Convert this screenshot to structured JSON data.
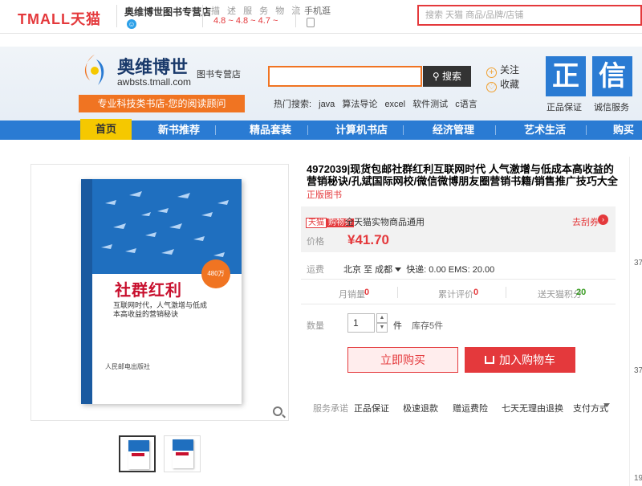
{
  "topbar": {
    "logo_text": "TMALL",
    "logo_cn": "天猫",
    "store_name": "奥维博世图书专营店",
    "ratings_label": "描 述 服 务 物 流",
    "ratings_values": "4.8 ~ 4.8 ~ 4.7 ~",
    "mobile_label": "手机逛",
    "search_placeholder": "搜索 天猫 商品/品牌/店铺"
  },
  "header": {
    "brand_title": "奥维博世",
    "brand_sub": "图书专营店",
    "brand_url": "awbsts.tmall.com",
    "slogan": "专业科技类书店-您的阅读顾问",
    "search_button": "搜索",
    "hot_search_label": "热门搜索:",
    "hot_search_items": [
      "java",
      "算法导论",
      "excel",
      "软件测试",
      "c语言"
    ],
    "follow": "关注",
    "collect": "收藏",
    "badge1_char": "正",
    "badge1_label": "正品保证",
    "badge2_char": "信",
    "badge2_label": "诚信服务"
  },
  "nav": {
    "items": [
      "首页",
      "新书推荐",
      "精品套装",
      "计算机书店",
      "经济管理",
      "艺术生活",
      "购买须知"
    ]
  },
  "cover": {
    "title": "社群红利",
    "subtitle": "互联网时代，人气激增与低成本高收益的营销秘诀",
    "circle": "480万",
    "bottom_text": "人民邮电出版社"
  },
  "product": {
    "title": "4972039|现货包邮社群红利互联网时代 人气激增与低成本高收益的营销秘诀/孔斌国际网校/微信微博朋友圈营销书籍/销售推广技巧大全",
    "tag": "正版图书",
    "tm_badge_a": "天猫",
    "tm_badge_b": "购物券",
    "promo_text": "全天猫实物商品通用",
    "coupon_link": "去刮券",
    "price_label": "价格",
    "price": "¥41.70",
    "ship_label": "运费",
    "ship_from": "北京",
    "ship_to_word": "至",
    "ship_dest": "成都",
    "ship_detail": "快递: 0.00 EMS: 20.00",
    "stats": [
      {
        "label": "月销量",
        "value": "0",
        "color": "#e4393c"
      },
      {
        "label": "累计评价",
        "value": "0",
        "color": "#e4393c"
      },
      {
        "label": "送天猫积分",
        "value": "20",
        "color": "#3a9d23"
      }
    ],
    "qty_label": "数量",
    "qty_value": "1",
    "qty_unit": "件",
    "stock": "库存5件",
    "buy_now": "立即购买",
    "add_cart": "加入购物车",
    "service_label": "服务承诺",
    "services": [
      "正品保证",
      "极速退款",
      "赠运费险",
      "七天无理由退换",
      "支付方式"
    ]
  },
  "edge": {
    "nums": [
      "37",
      "37",
      "19"
    ]
  }
}
